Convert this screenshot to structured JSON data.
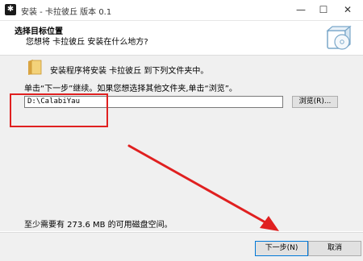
{
  "window": {
    "title": "安装 - 卡拉彼丘 版本 0.1",
    "minimize_glyph": "—",
    "maximize_glyph": "☐",
    "close_glyph": "✕"
  },
  "header": {
    "title": "选择目标位置",
    "subtitle": "您想将 卡拉彼丘 安装在什么地方?"
  },
  "body": {
    "install_message": "安装程序将安装 卡拉彼丘 到下列文件夹中。",
    "hint": "单击“下一步”继续。如果您想选择其他文件夹,单击“浏览”。",
    "path_value": "D:\\CalabiYau",
    "browse_label": "浏览(R)...",
    "space_message": "至少需要有 273.6 MB 的可用磁盘空间。"
  },
  "footer": {
    "next_label": "下一步(N)",
    "cancel_label": "取消"
  },
  "icons": [
    "setup-app-icon",
    "folder-icon",
    "setup-disc-logo-icon"
  ],
  "colors": {
    "annotation": "#e02020",
    "primary_button_border": "#0078d7"
  }
}
